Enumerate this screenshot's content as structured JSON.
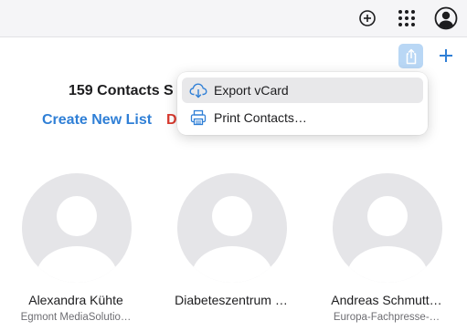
{
  "toolbar": {
    "add_icon": "plus-circle-icon",
    "apps_icon": "app-grid-icon",
    "account_icon": "account-circle-icon"
  },
  "actions": {
    "share_icon": "share-icon",
    "new_contact_icon": "plus-icon"
  },
  "header": {
    "count_text": "159 Contacts S",
    "create_new_list": "Create New List",
    "delete_partial": "D"
  },
  "menu": {
    "items": [
      {
        "label": "Export vCard",
        "icon": "cloud-download-icon",
        "highlighted": true
      },
      {
        "label": "Print Contacts…",
        "icon": "printer-icon",
        "highlighted": false
      }
    ]
  },
  "contacts": [
    {
      "name": "Alexandra Kühte",
      "company": "Egmont MediaSolutio…"
    },
    {
      "name": "Diabeteszentrum …",
      "company": ""
    },
    {
      "name": "Andreas Schmutt…",
      "company": "Europa-Fachpresse-…"
    }
  ],
  "colors": {
    "accent": "#2f7fd6",
    "destructive": "#d93a2f",
    "share_button_bg": "#b9d7f5",
    "menu_highlight": "#e8e8ea",
    "avatar_bg": "#e5e5e8",
    "avatar_fg": "#ffffff"
  }
}
